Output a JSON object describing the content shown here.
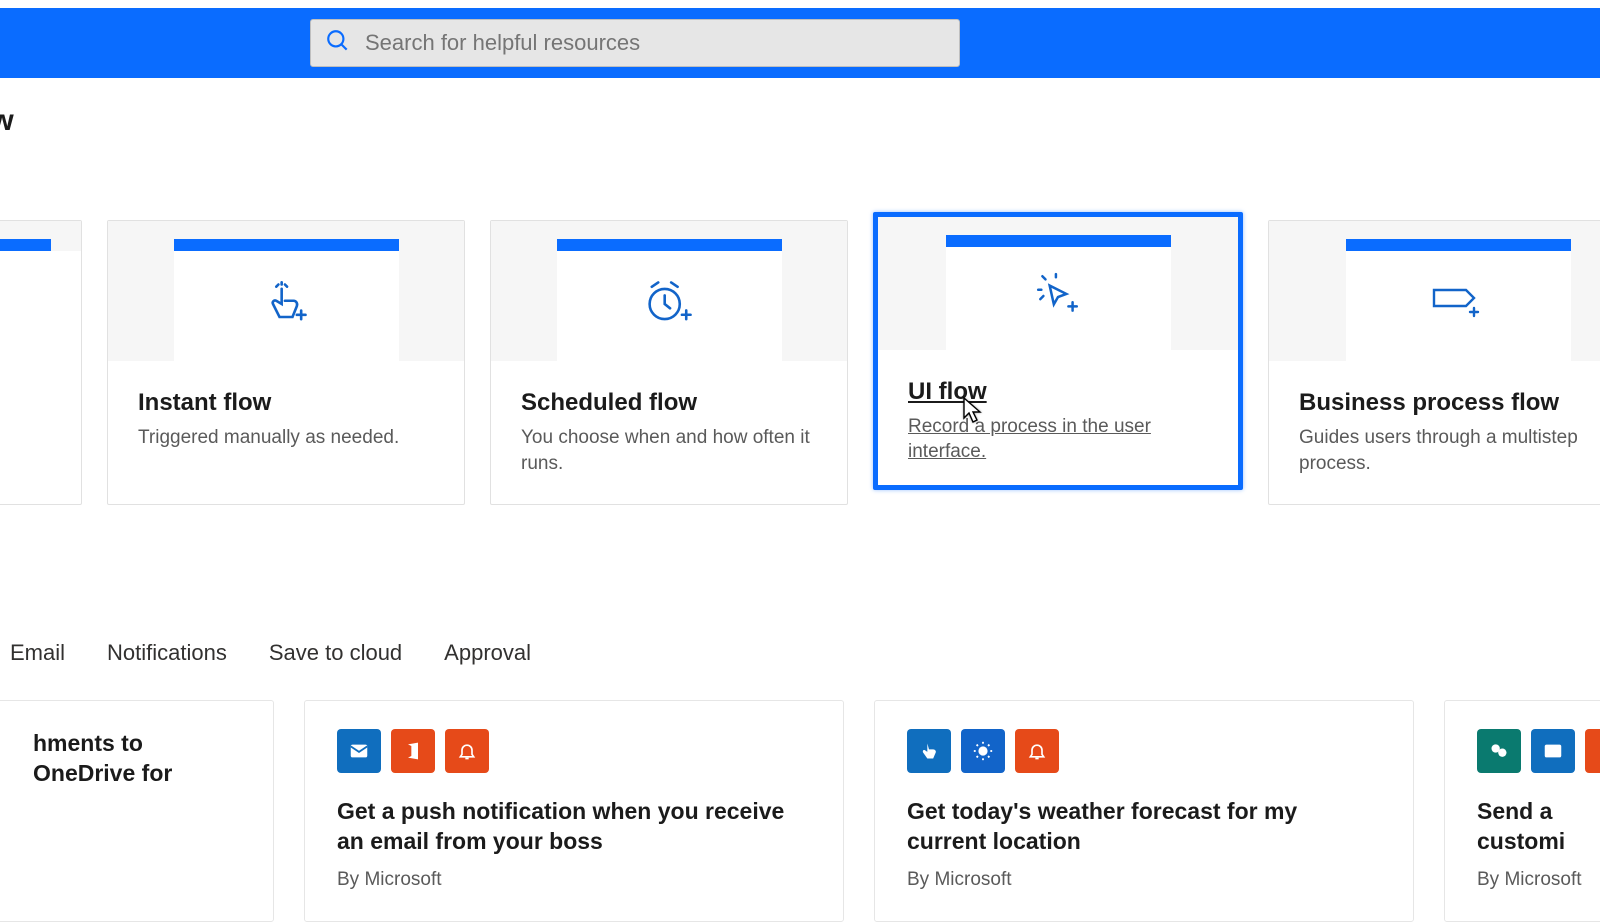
{
  "header": {
    "search_placeholder": "Search for helpful resources"
  },
  "page_title_fragment": "ow",
  "flow_cards": [
    {
      "title": "",
      "desc": ""
    },
    {
      "title": "Instant flow",
      "desc": "Triggered manually as needed."
    },
    {
      "title": "Scheduled flow",
      "desc": "You choose when and how often it runs."
    },
    {
      "title": "UI flow",
      "desc": "Record a process in the user interface."
    },
    {
      "title": "Business process flow",
      "desc": "Guides users through a multistep process."
    }
  ],
  "filter_tabs": [
    "Email",
    "Notifications",
    "Save to cloud",
    "Approval"
  ],
  "templates": [
    {
      "title": "hments to OneDrive for",
      "author": ""
    },
    {
      "title": "Get a push notification when you receive an email from your boss",
      "author": "By Microsoft"
    },
    {
      "title": "Get today's weather forecast for my current location",
      "author": "By Microsoft"
    },
    {
      "title": "Send a customi",
      "author": "By Microsoft"
    }
  ],
  "colors": {
    "brand": "#0a6cff",
    "orange": "#e64a19",
    "teal": "#0a7a6f"
  }
}
